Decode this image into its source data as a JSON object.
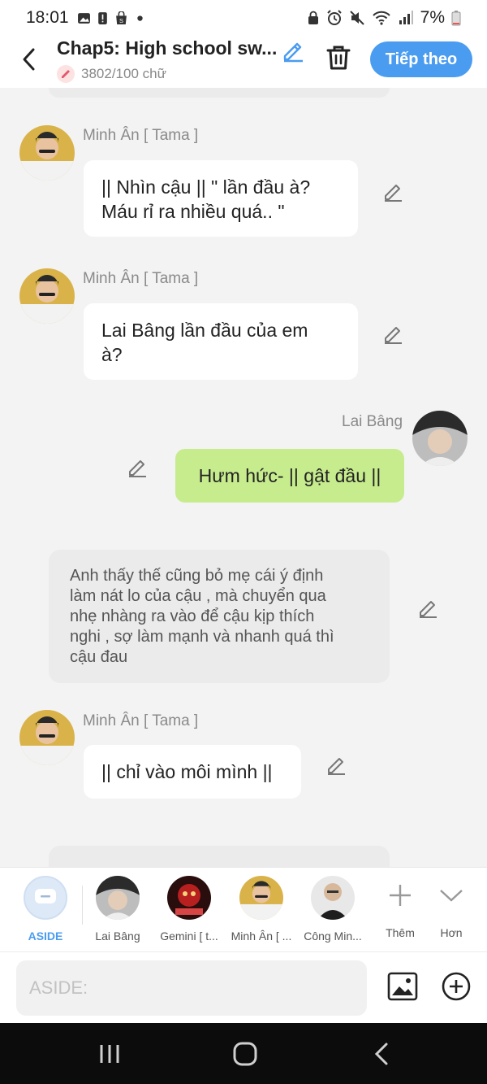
{
  "status_bar": {
    "time": "18:01",
    "battery": "7%"
  },
  "header": {
    "title": "Chap5: High school sw...",
    "word_count": "3802/100 chữ",
    "next_button": "Tiếp theo"
  },
  "messages": [
    {
      "type": "received",
      "sender": "Minh Ân [ Tama ]",
      "text": "|| Nhìn cậu || \" lần đầu à?\nMáu rỉ ra nhiều quá.. \""
    },
    {
      "type": "received",
      "sender": "Minh Ân [ Tama ]",
      "text": "Lai Bâng lần đầu của em\nà?"
    },
    {
      "type": "sent",
      "sender": "Lai Bâng",
      "text": "Hưm hức- || gật đầu ||"
    },
    {
      "type": "aside",
      "text": "Anh thấy thế cũng bỏ mẹ cái ý định\nlàm nát lo của cậu , mà chuyển qua\nnhẹ nhàng ra vào để cậu kịp thích\nnghi , sợ làm mạnh và nhanh quá thì\ncậu đau"
    },
    {
      "type": "received",
      "sender": "Minh Ân [ Tama ]",
      "text": "|| chỉ vào môi mình ||"
    }
  ],
  "characters": [
    {
      "label": "ASIDE"
    },
    {
      "label": "Lai Bâng"
    },
    {
      "label": "Gemini [ t..."
    },
    {
      "label": "Minh Ân [ ..."
    },
    {
      "label": "Công Min..."
    }
  ],
  "tools": {
    "more_label": "Thêm",
    "expand_label": "Hơn"
  },
  "input": {
    "placeholder": "ASIDE:"
  },
  "colors": {
    "accent": "#4a9cf0",
    "sent_bubble": "#c7ec8e",
    "aside_bg": "#ebebeb",
    "background": "#f3f3f3"
  }
}
